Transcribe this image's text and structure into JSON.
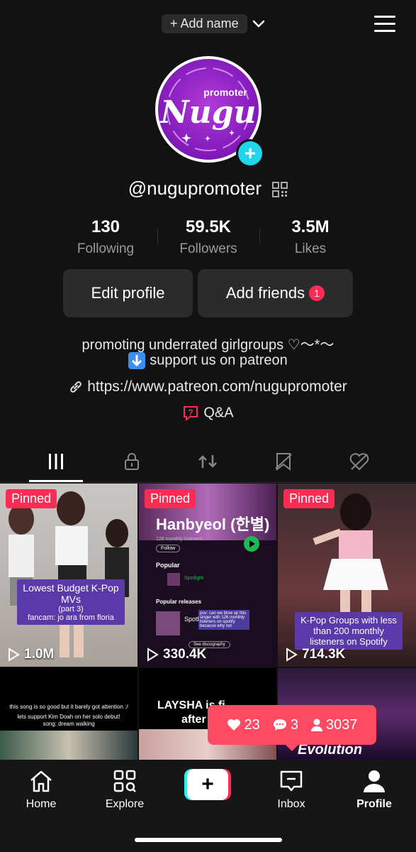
{
  "header": {
    "add_name": "+ Add name"
  },
  "profile": {
    "avatar_text": "Nugu",
    "avatar_subtext": "promoter",
    "username": "@nugupromoter"
  },
  "stats": [
    {
      "value": "130",
      "label": "Following"
    },
    {
      "value": "59.5K",
      "label": "Followers"
    },
    {
      "value": "3.5M",
      "label": "Likes"
    }
  ],
  "buttons": {
    "edit_profile": "Edit profile",
    "add_friends": "Add friends",
    "add_friends_badge": "1"
  },
  "bio": {
    "line1": "promoting underrated girlgroups ♡〜*〜",
    "line2": "support us on patreon",
    "link": "https://www.patreon.com/nugupromoter",
    "qa": "Q&A"
  },
  "tabs": [
    "videos",
    "private",
    "reposts",
    "favorites",
    "liked"
  ],
  "videos": [
    {
      "pinned": "Pinned",
      "views": "1.0M",
      "caption": "Lowest Budget K-Pop MVs",
      "sub1": "(part 3)",
      "sub2": "fancam: jo ara from floria"
    },
    {
      "pinned": "Pinned",
      "views": "330.4K",
      "title": "Hanbyeol (한별)",
      "listeners": "126 monthly listeners",
      "follow": "Follow",
      "popular": "Popular",
      "track": "Spotlight",
      "popular_releases": "Popular releases",
      "release": "Spotl",
      "see_disco": "See discography",
      "overlay": "pov: can we blow up this singer with 126 monthly listeners on spotify because why not"
    },
    {
      "pinned": "Pinned",
      "views": "714.3K",
      "caption": "K-Pop Groups with less than 200 monthly listeners on Spotify"
    },
    {
      "line1": "this song is so good but it barely got attention :/",
      "line2": "lets support Kim Doah on her solo debut!",
      "line3": "song: dream walking"
    },
    {
      "title": "LAYSHA is fi",
      "title2": "after 4"
    },
    {
      "overlay": "Evolution"
    }
  ],
  "notification": {
    "likes": "23",
    "comments": "3",
    "followers": "3037"
  },
  "nav": [
    {
      "label": "Home"
    },
    {
      "label": "Explore"
    },
    {
      "label": "Inbox"
    },
    {
      "label": "Profile"
    }
  ],
  "colors": {
    "accent": "#fe2c55",
    "teal": "#20d5ec",
    "background": "#121212"
  }
}
